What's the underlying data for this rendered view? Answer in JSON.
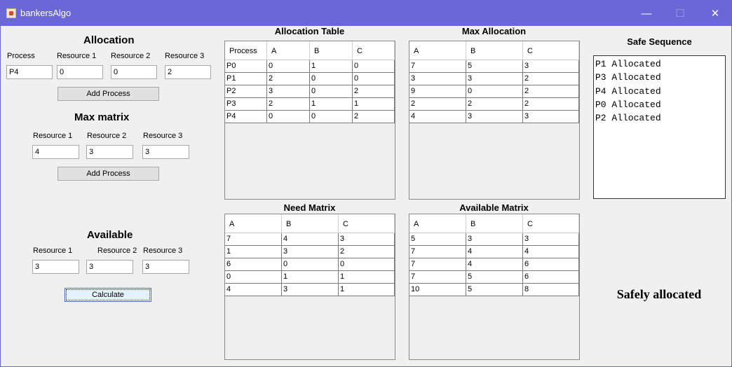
{
  "window": {
    "title": "bankersAlgo",
    "minimize": "—",
    "maximize": "☐",
    "close": "✕"
  },
  "allocation": {
    "heading": "Allocation",
    "labels": {
      "process": "Process",
      "r1": "Resource 1",
      "r2": "Resource 2",
      "r3": "Resource 3"
    },
    "values": {
      "process": "P4",
      "r1": "0",
      "r2": "0",
      "r3": "2"
    },
    "button": "Add Process"
  },
  "max_matrix": {
    "heading": "Max matrix",
    "labels": {
      "r1": "Resource 1",
      "r2": "Resource 2",
      "r3": "Resource 3"
    },
    "values": {
      "r1": "4",
      "r2": "3",
      "r3": "3"
    },
    "button": "Add Process"
  },
  "available": {
    "heading": "Available",
    "labels": {
      "r1": "Resource 1",
      "r2": "Resource 2",
      "r3": "Resource 3"
    },
    "values": {
      "r1": "3",
      "r2": "3",
      "r3": "3"
    },
    "button": "Calculate"
  },
  "tables": {
    "allocation_table": {
      "title": "Allocation Table",
      "columns": [
        "Process",
        "A",
        "B",
        "C"
      ],
      "rows": [
        [
          "P0",
          "0",
          "1",
          "0"
        ],
        [
          "P1",
          "2",
          "0",
          "0"
        ],
        [
          "P2",
          "3",
          "0",
          "2"
        ],
        [
          "P3",
          "2",
          "1",
          "1"
        ],
        [
          "P4",
          "0",
          "0",
          "2"
        ]
      ]
    },
    "max_allocation": {
      "title": "Max Allocation",
      "columns": [
        "A",
        "B",
        "C"
      ],
      "rows": [
        [
          "7",
          "5",
          "3"
        ],
        [
          "3",
          "3",
          "2"
        ],
        [
          "9",
          "0",
          "2"
        ],
        [
          "2",
          "2",
          "2"
        ],
        [
          "4",
          "3",
          "3"
        ]
      ]
    },
    "need_matrix": {
      "title": "Need Matrix",
      "columns": [
        "A",
        "B",
        "C"
      ],
      "rows": [
        [
          "7",
          "4",
          "3"
        ],
        [
          "1",
          "3",
          "2"
        ],
        [
          "6",
          "0",
          "0"
        ],
        [
          "0",
          "1",
          "1"
        ],
        [
          "4",
          "3",
          "1"
        ]
      ]
    },
    "available_matrix": {
      "title": "Available Matrix",
      "columns": [
        "A",
        "B",
        "C"
      ],
      "rows": [
        [
          "5",
          "3",
          "3"
        ],
        [
          "7",
          "4",
          "4"
        ],
        [
          "7",
          "4",
          "6"
        ],
        [
          "7",
          "5",
          "6"
        ],
        [
          "10",
          "5",
          "8"
        ]
      ]
    }
  },
  "safe_sequence": {
    "heading": "Safe Sequence",
    "lines": [
      "P1 Allocated",
      "P3 Allocated",
      "P4 Allocated",
      "P0 Allocated",
      "P2 Allocated"
    ]
  },
  "status_text": "Safely allocated",
  "colors": {
    "titlebar": "#6a67d6",
    "panel": "#f0f0f0",
    "table_border": "#7a7a7a"
  }
}
